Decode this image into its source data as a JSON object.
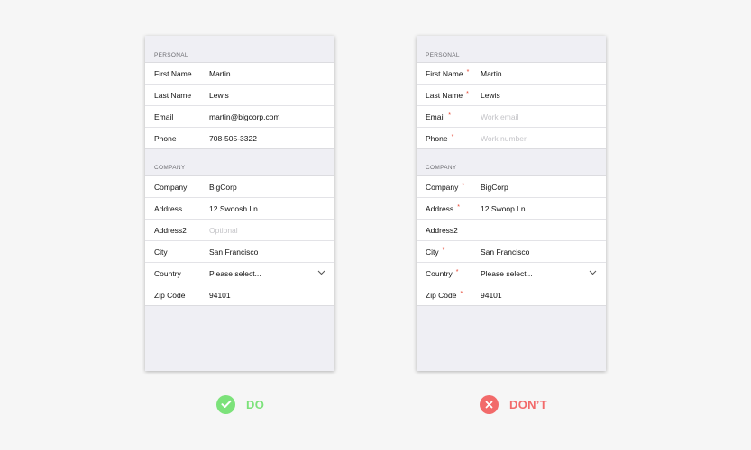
{
  "good_form": {
    "personal_header": "PERSONAL",
    "personal_rows": [
      {
        "label": "First Name",
        "value": "Martin"
      },
      {
        "label": "Last Name",
        "value": "Lewis"
      },
      {
        "label": "Email",
        "value": "martin@bigcorp.com"
      },
      {
        "label": "Phone",
        "value": "708-505-3322"
      }
    ],
    "company_header": "COMPANY",
    "company_rows": [
      {
        "label": "Company",
        "value": "BigCorp"
      },
      {
        "label": "Address",
        "value": "12 Swoosh Ln"
      },
      {
        "label": "Address2",
        "value": "",
        "placeholder": "Optional"
      },
      {
        "label": "City",
        "value": "San Francisco"
      },
      {
        "label": "Country",
        "value": "Please select...",
        "icon": "chevron-down-icon"
      },
      {
        "label": "Zip Code",
        "value": "94101"
      }
    ]
  },
  "bad_form": {
    "personal_header": "PERSONAL",
    "required_marker": "*",
    "personal_rows": [
      {
        "label": "First Name",
        "value": "Martin"
      },
      {
        "label": "Last Name",
        "value": "Lewis"
      },
      {
        "label": "Email",
        "value": "",
        "placeholder": "Work email"
      },
      {
        "label": "Phone",
        "value": "",
        "placeholder": "Work number"
      }
    ],
    "company_header": "COMPANY",
    "company_rows": [
      {
        "label": "Company",
        "value": "BigCorp"
      },
      {
        "label": "Address",
        "value": "12 Swoop Ln"
      },
      {
        "label": "Address2",
        "value": ""
      },
      {
        "label": "City",
        "value": "San Francisco"
      },
      {
        "label": "Country",
        "value": "Please select...",
        "icon": "chevron-down-icon"
      },
      {
        "label": "Zip Code",
        "value": "94101"
      }
    ]
  },
  "verdicts": {
    "do_label": "DO",
    "do_icon": "checkmark-icon",
    "do_color": "#7ce27a",
    "dont_label": "DON’T",
    "dont_icon": "cross-icon",
    "dont_color": "#f26a6a"
  },
  "colors": {
    "required_marker": "#e5412d",
    "section_background": "#efeff4"
  }
}
